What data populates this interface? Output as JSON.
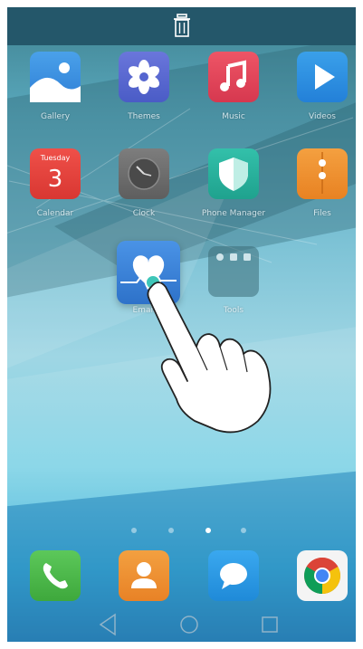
{
  "labels": {
    "gallery": "Gallery",
    "themes": "Themes",
    "music": "Music",
    "videos": "Videos",
    "calendar": "Calendar",
    "clock": "Clock",
    "phone_manager": "Phone Manager",
    "files": "Files",
    "email": "Email",
    "tools": "Tools"
  },
  "calendar_icon": {
    "weekday": "Tuesday",
    "day": "3"
  },
  "page_indicator": {
    "pages": 4,
    "active": 3
  },
  "colors": {
    "gallery": "#3b8fe0",
    "themes": "#5b6bd0",
    "music": "#e5445a",
    "videos": "#2f8fdf",
    "calendar": "#e8433f",
    "clock": "#6d6d6d",
    "phone_manager": "#27b59e",
    "files": "#f0932c",
    "email": "#3b82d6",
    "phone": "#4cb84c",
    "contacts": "#ef8f2c",
    "messaging": "#2c9ae8"
  }
}
